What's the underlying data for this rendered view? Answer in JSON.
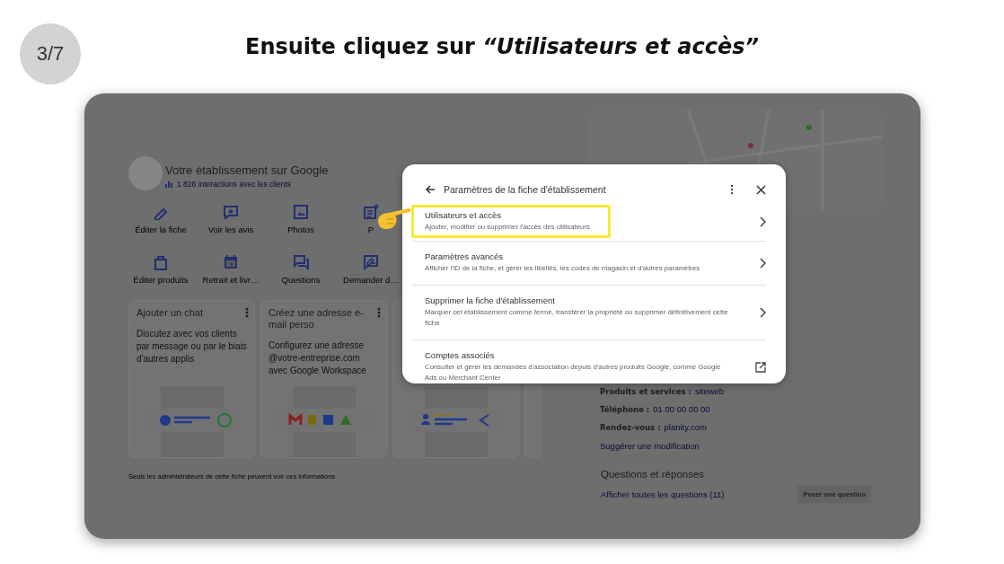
{
  "step_badge": "3/7",
  "heading": "Ensuite cliquez sur *“Utilisateurs et accès”*",
  "business": {
    "title": "Votre établissement sur Google",
    "interactions": "1 828 interactions avec les clients"
  },
  "actions": [
    {
      "kind": "edit",
      "label": "Éditer la fiche"
    },
    {
      "kind": "reviews",
      "label": "Voir les avis"
    },
    {
      "kind": "photos",
      "label": "Photos"
    },
    {
      "kind": "post",
      "label": "P"
    },
    {
      "kind": "products",
      "label": "Éditer produits"
    },
    {
      "kind": "calendar",
      "label": "Retrait et livr…"
    },
    {
      "kind": "questions",
      "label": "Questions"
    },
    {
      "kind": "request",
      "label": "Demander d…"
    }
  ],
  "cards": [
    {
      "kind": "chat",
      "title": "Ajouter un chat",
      "text": "Discutez avec vos clients par message ou par le biais d'autres applis"
    },
    {
      "kind": "workspace",
      "title": "Créez une adresse e-mail perso",
      "text": "Configurez une adresse @votre-entreprise.com avec Google Workspace"
    },
    {
      "kind": "share"
    }
  ],
  "footer_note": "Seuls les administrateurs de cette fiche peuvent voir ces informations",
  "details": [
    {
      "label": "Produits et services :",
      "value": "siteweb"
    },
    {
      "label": "Téléphone :",
      "value": "01 00 00 00 00"
    },
    {
      "label": "Rendez-vous :",
      "value": "planity.com"
    }
  ],
  "suggest_link": "Suggérer une modification",
  "qa": {
    "title": "Questions et réponses",
    "link": "Afficher toutes les questions (11)",
    "button": "Poser une question"
  },
  "dialog": {
    "title": "Paramètres de la fiche d'établissement",
    "items": [
      {
        "kind": "chevron",
        "highlighted": true,
        "title": "Utilisateurs et accès",
        "description": "Ajouter, modifier ou supprimer l'accès des utilisateurs"
      },
      {
        "kind": "chevron",
        "highlighted": false,
        "title": "Paramètres avancés",
        "description": "Afficher l'ID de la fiche, et gérer les libellés, les codes de magasin et d'autres paramètres"
      },
      {
        "kind": "chevron",
        "highlighted": false,
        "title": "Supprimer la fiche d'établissement",
        "description": "Marquer cet établissement comme fermé, transférer la propriété ou supprimer définitivement cette fiche"
      },
      {
        "kind": "external",
        "highlighted": false,
        "title": "Comptes associés",
        "description": "Consulter et gérer les demandes d'association depuis d'autres produits Google, comme Google Ads ou Merchant Center"
      }
    ]
  }
}
